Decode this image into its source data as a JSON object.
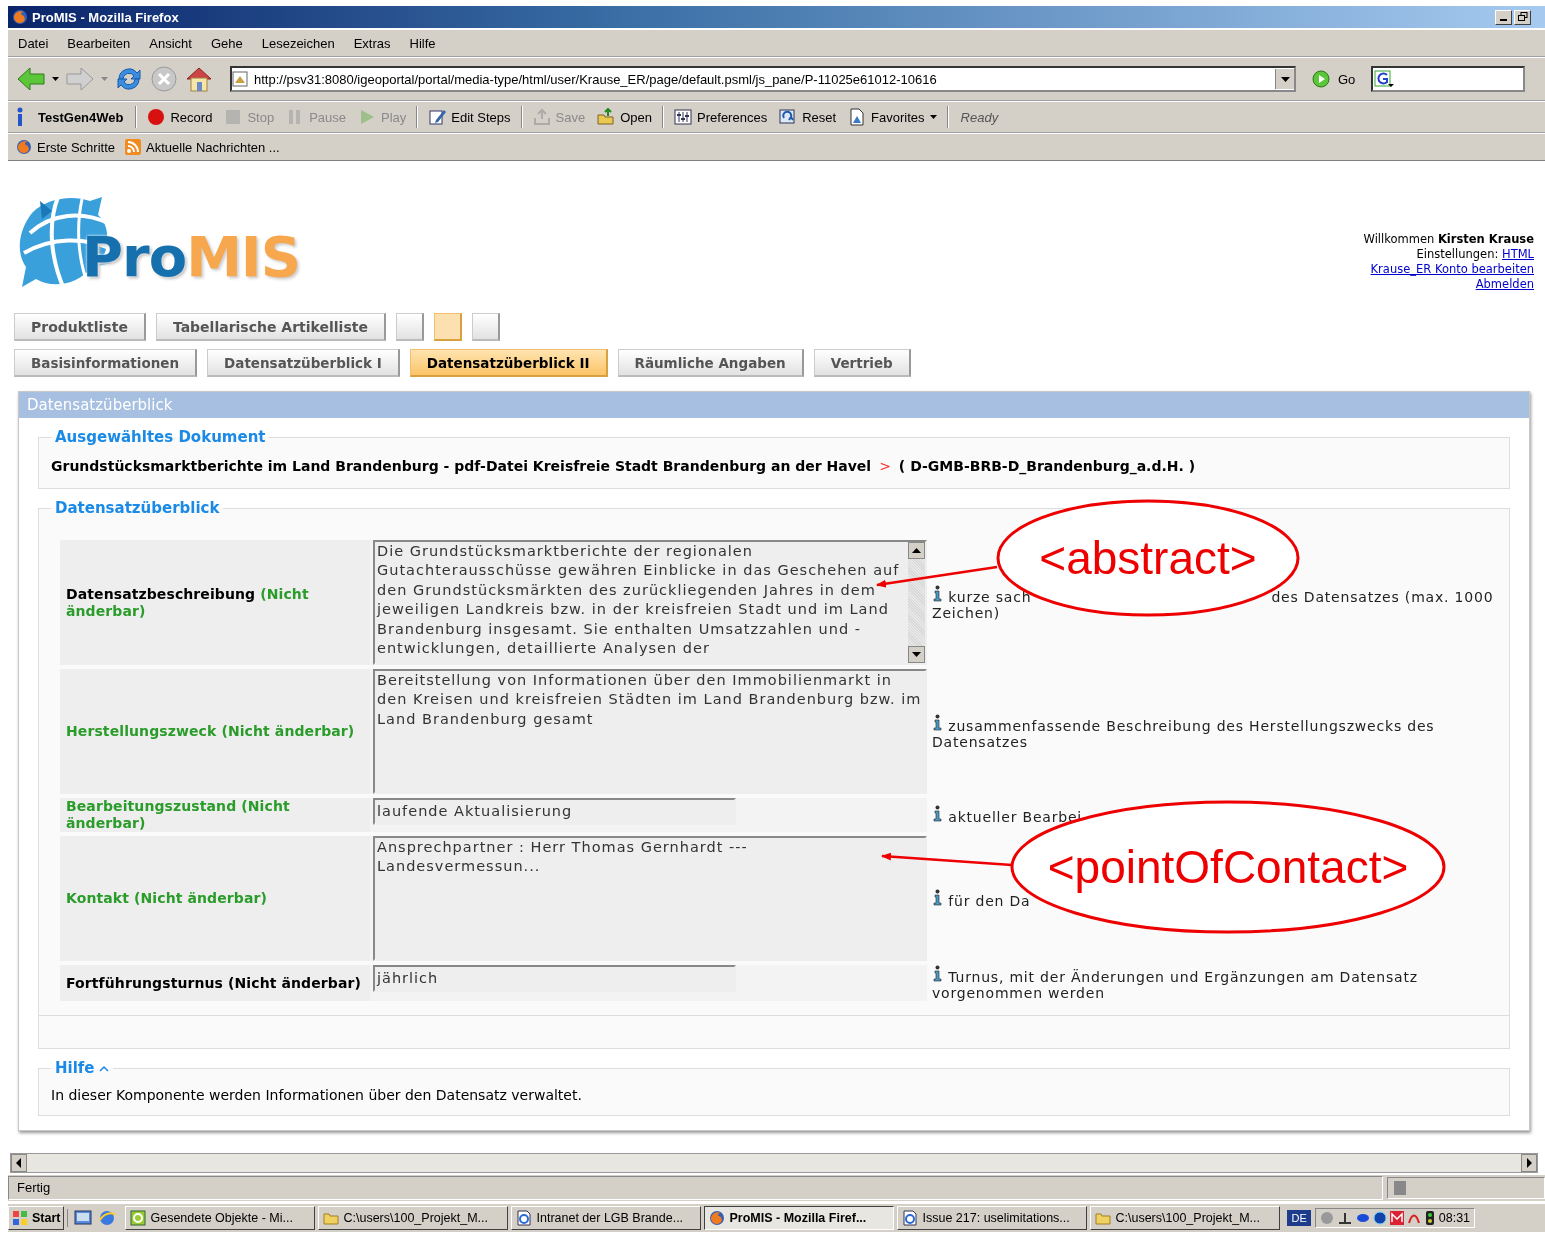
{
  "window": {
    "title": "ProMIS - Mozilla Firefox"
  },
  "menu_bar": [
    {
      "label": "Datei"
    },
    {
      "label": "Bearbeiten"
    },
    {
      "label": "Ansicht"
    },
    {
      "label": "Gehe"
    },
    {
      "label": "Lesezeichen"
    },
    {
      "label": "Extras"
    },
    {
      "label": "Hilfe"
    }
  ],
  "navigation_toolbar": {
    "url": "http://psv31:8080/igeoportal/portal/media-type/html/user/Krause_ER/page/default.psml/js_pane/P-11025e61012-10616",
    "go_label": "Go"
  },
  "testgen_toolbar": {
    "title": "TestGen4Web",
    "status": "Ready",
    "buttons": [
      {
        "kind": "record",
        "label": "Record",
        "disabled": false,
        "separator_before": true
      },
      {
        "kind": "stop",
        "label": "Stop",
        "disabled": true,
        "separator_before": false
      },
      {
        "kind": "pause",
        "label": "Pause",
        "disabled": true,
        "separator_before": false
      },
      {
        "kind": "play",
        "label": "Play",
        "disabled": true,
        "separator_before": false
      },
      {
        "kind": "edit",
        "label": "Edit Steps",
        "disabled": false,
        "separator_before": true
      },
      {
        "kind": "save",
        "label": "Save",
        "disabled": true,
        "separator_before": true
      },
      {
        "kind": "open",
        "label": "Open",
        "disabled": false,
        "separator_before": false
      },
      {
        "kind": "preferences",
        "label": "Preferences",
        "disabled": false,
        "separator_before": true
      },
      {
        "kind": "reset",
        "label": "Reset",
        "disabled": false,
        "separator_before": false
      },
      {
        "kind": "favorites",
        "label": "Favorites",
        "disabled": false,
        "separator_before": false
      }
    ]
  },
  "bookmarks_toolbar": [
    {
      "kind": "firefox",
      "label": "Erste Schritte"
    },
    {
      "kind": "feed",
      "label": "Aktuelle Nachrichten ..."
    }
  ],
  "page": {
    "logo": {
      "first": "Pro",
      "second": "MIS"
    },
    "user_panel": {
      "greeting": "Willkommen",
      "name": "Kirsten Krause",
      "settings_label": "Einstellungen:",
      "settings_link": "HTML",
      "account_link": "Krause_ER Konto bearbeiten",
      "logout_link": "Abmelden"
    },
    "top_tabs": [
      {
        "label": "Produktliste",
        "selected": false
      },
      {
        "label": "Tabellarische Artikelliste",
        "selected": false
      },
      {
        "selected": false
      },
      {
        "selected": true
      },
      {
        "selected": false
      }
    ],
    "sub_tabs": [
      {
        "label": "Basisinformationen",
        "selected": false
      },
      {
        "label": "Datensatzüberblick I",
        "selected": false
      },
      {
        "label": "Datensatzüberblick II",
        "selected": true
      },
      {
        "label": "Räumliche Angaben",
        "selected": false
      },
      {
        "label": "Vertrieb",
        "selected": false
      }
    ],
    "panel": {
      "title": "Datensatzüberblick",
      "document": {
        "legend": "Ausgewähltes Dokument",
        "title": "Grundstücksmarktberichte im Land Brandenburg - pdf-Datei Kreisfreie Stadt Brandenburg an der Havel",
        "separator": ">",
        "id": "( D-GMB-BRB-D_Brandenburg_a.d.H. )"
      },
      "overview": {
        "legend": "Datensatzüberblick",
        "rows": [
          {
            "name": "Datensatzbeschreibung",
            "note": "(Nicht änderbar)",
            "name_highlighted": false,
            "note_highlighted": true,
            "kind": "scrollbox",
            "value": "Die Grundstücksmarktberichte der regionalen Gutachterausschüsse gewähren Einblicke in das Geschehen auf den Grundstücksmärkten des zurückliegenden Jahres in dem jeweiligen Landkreis bzw. in der kreisfreien Stadt und im Land Brandenburg insgesamt. Sie enthalten Umsatzzahlen und -entwicklungen, detaillierte Analysen der",
            "hint": [
              "kurze sach",
              "des Datensatzes (max. 1000 Zeichen)"
            ]
          },
          {
            "name": "Herstellungszweck",
            "note": "(Nicht änderbar)",
            "name_highlighted": true,
            "note_highlighted": true,
            "kind": "box",
            "value": "Bereitstellung von Informationen über den Immobilienmarkt in den Kreisen und kreisfreien Städten im Land Brandenburg bzw. im Land Brandenburg gesamt",
            "hint": [
              "zusammenfassende Beschreibung des Herstellungszwecks des Datensatzes"
            ]
          },
          {
            "name": "Bearbeitungszustand",
            "note": "(Nicht änderbar)",
            "name_highlighted": true,
            "note_highlighted": true,
            "kind": "input",
            "value": "laufende Aktualisierung",
            "hint": [
              "aktueller Bearbei"
            ]
          },
          {
            "name": "Kontakt",
            "note": "(Nicht änderbar)",
            "name_highlighted": true,
            "note_highlighted": true,
            "kind": "box",
            "value": "Ansprechpartner : Herr Thomas Gernhardt ---\nLandesvermessun...",
            "hint": [
              "für den Da"
            ]
          },
          {
            "name": "Fortführungsturnus",
            "note": "(Nicht änderbar)",
            "name_highlighted": false,
            "note_highlighted": false,
            "kind": "input",
            "value": "jährlich",
            "hint": [
              "Turnus, mit der Änderungen und Ergänzungen am Datensatz vorgenommen werden"
            ]
          }
        ]
      },
      "help": {
        "legend": "Hilfe",
        "text": "In dieser Komponente werden Informationen über den Datensatz verwaltet."
      }
    }
  },
  "annotations": [
    {
      "label": "<abstract>"
    },
    {
      "label": "<pointOfContact>"
    }
  ],
  "status_bar": {
    "text": "Fertig"
  },
  "taskbar": {
    "start": "Start",
    "tasks": [
      {
        "kind": "mail",
        "label": "Gesendete Objekte - Mi...",
        "selected": false
      },
      {
        "kind": "folder",
        "label": "C:\\users\\100_Projekt_M...",
        "selected": false
      },
      {
        "kind": "browser",
        "label": "Intranet der LGB Brande...",
        "selected": false
      },
      {
        "kind": "firefox",
        "label": "ProMIS - Mozilla Firef...",
        "selected": true
      },
      {
        "kind": "browser",
        "label": "Issue 217: uselimitations...",
        "selected": false
      },
      {
        "kind": "folder",
        "label": "C:\\users\\100_Projekt_M...",
        "selected": false
      }
    ],
    "language": "DE",
    "clock": "08:31"
  }
}
